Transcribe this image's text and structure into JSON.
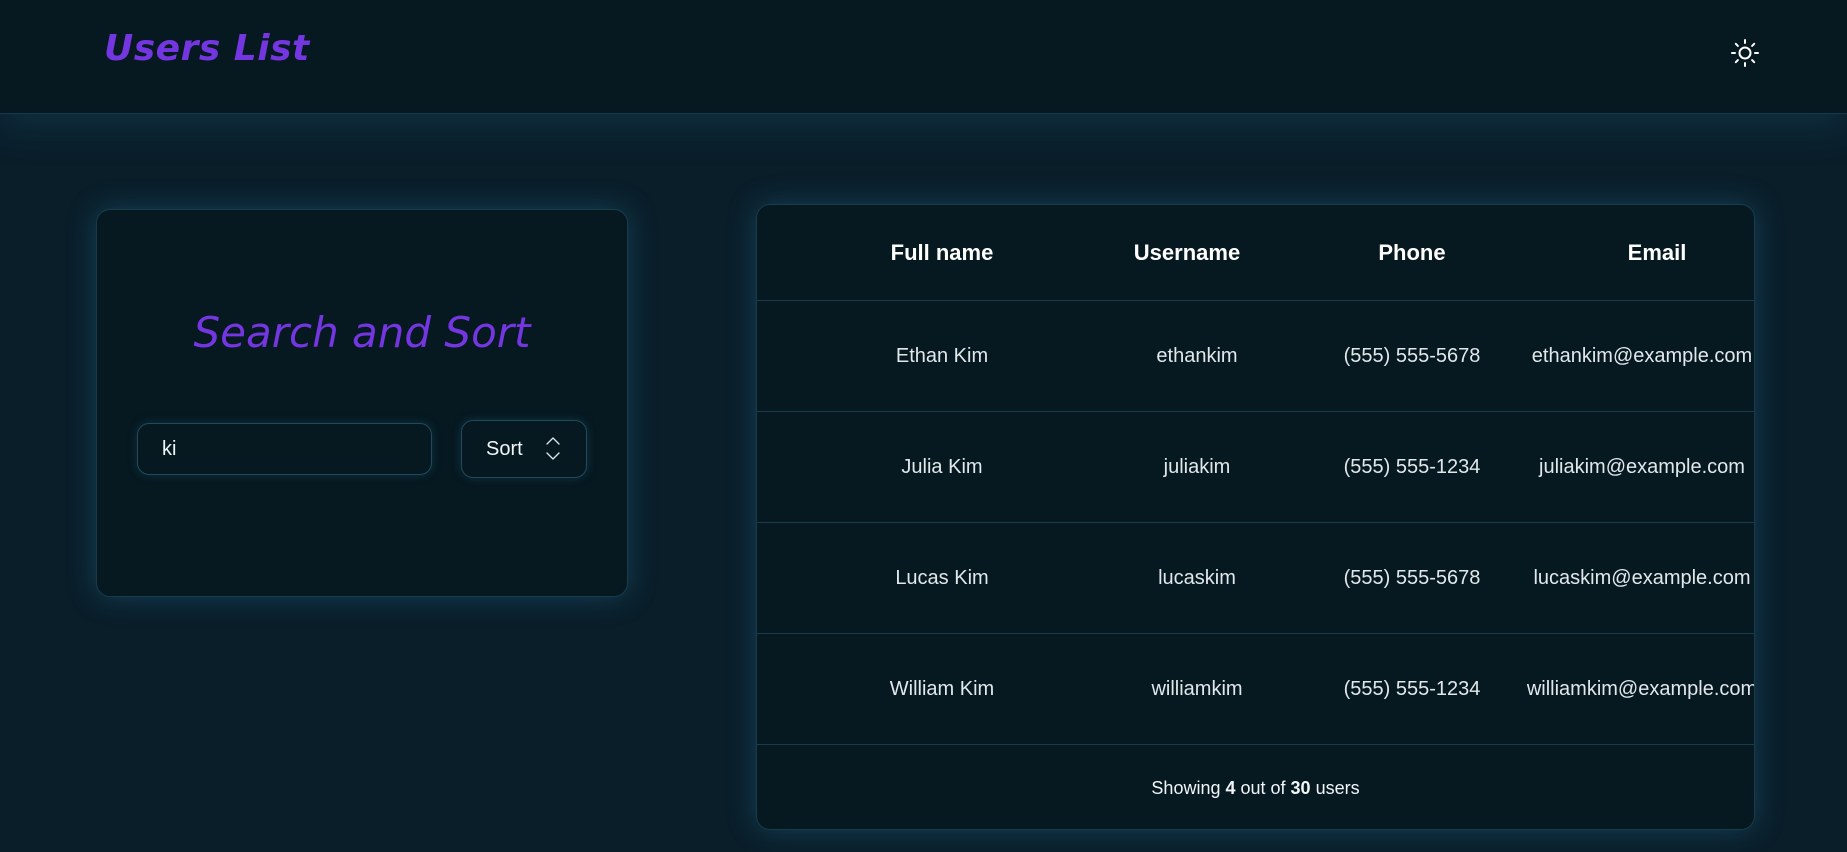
{
  "header": {
    "title": "Users List",
    "theme_toggle_icon": "sun-icon"
  },
  "search_panel": {
    "title": "Search and Sort",
    "search_value": "ki",
    "sort_label": "Sort",
    "sort_icon": "chevron-up-down-icon"
  },
  "table": {
    "columns": [
      "Full name",
      "Username",
      "Phone",
      "Email"
    ],
    "rows": [
      {
        "full_name": "Ethan Kim",
        "username": "ethankim",
        "phone": "(555) 555-5678",
        "email": "ethankim@example.com"
      },
      {
        "full_name": "Julia Kim",
        "username": "juliakim",
        "phone": "(555) 555-1234",
        "email": "juliakim@example.com"
      },
      {
        "full_name": "Lucas Kim",
        "username": "lucaskim",
        "phone": "(555) 555-5678",
        "email": "lucaskim@example.com"
      },
      {
        "full_name": "William Kim",
        "username": "williamkim",
        "phone": "(555) 555-1234",
        "email": "williamkim@example.com"
      }
    ],
    "footer": {
      "prefix": "Showing",
      "shown": "4",
      "middle": "out of",
      "total": "30",
      "suffix": "users"
    }
  },
  "colors": {
    "accent": "#7436e0",
    "background": "#0a1e2a",
    "panel": "#061820",
    "border": "#1a3b4c"
  }
}
